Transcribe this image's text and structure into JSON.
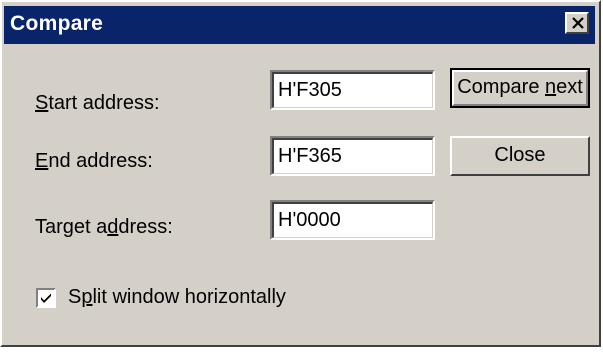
{
  "window": {
    "title": "Compare"
  },
  "fields": [
    {
      "label_pre": "",
      "label_key": "S",
      "label_post": "tart address:",
      "value": "H'F305"
    },
    {
      "label_pre": "",
      "label_key": "E",
      "label_post": "nd address:",
      "value": "H'F365"
    },
    {
      "label_pre": "Target a",
      "label_key": "d",
      "label_post": "dress:",
      "value": "H'0000"
    }
  ],
  "buttons": {
    "compare_next_pre": "Compare ",
    "compare_next_key": "n",
    "compare_next_post": "ext",
    "close_label": "Close"
  },
  "options": {
    "split_pre": "S",
    "split_key": "p",
    "split_post": "lit window horizontally",
    "split_checked": true
  },
  "colors": {
    "titlebar": "#0a246a",
    "face": "#d4d0c8"
  }
}
